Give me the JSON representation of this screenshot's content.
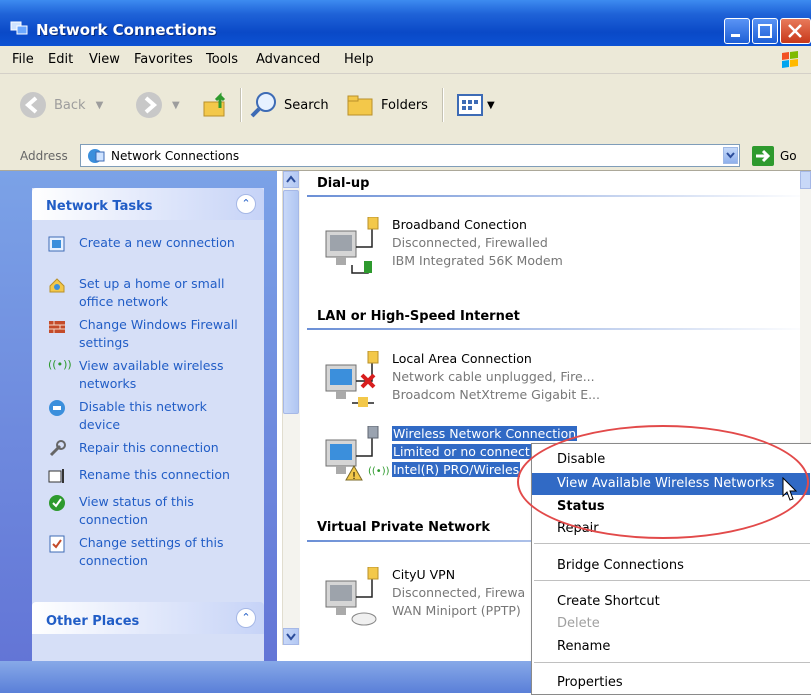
{
  "window": {
    "title": "Network Connections"
  },
  "menu": [
    "File",
    "Edit",
    "View",
    "Favorites",
    "Tools",
    "Advanced",
    "Help"
  ],
  "toolbar": {
    "back": "Back",
    "search": "Search",
    "folders": "Folders"
  },
  "address": {
    "label": "Address",
    "value": "Network Connections",
    "go": "Go"
  },
  "network_tasks": {
    "title": "Network Tasks",
    "items": [
      {
        "label": "Create a new connection"
      },
      {
        "label": "Set up a home or small office network"
      },
      {
        "label": "Change Windows Firewall settings"
      },
      {
        "label": "View available wireless networks"
      },
      {
        "label": "Disable this network device"
      },
      {
        "label": "Repair this connection"
      },
      {
        "label": "Rename this connection"
      },
      {
        "label": "View status of this connection"
      },
      {
        "label": "Change settings of this connection"
      }
    ]
  },
  "other_places": {
    "title": "Other Places"
  },
  "groups": {
    "dialup": {
      "title": "Dial-up",
      "item": {
        "name": "Broadband Conection",
        "status": "Disconnected, Firewalled",
        "device": "IBM Integrated 56K Modem"
      }
    },
    "lan": {
      "title": "LAN or High-Speed Internet",
      "local": {
        "name": "Local Area Connection",
        "status": "Network cable unplugged, Fire...",
        "device": "Broadcom NetXtreme Gigabit E..."
      },
      "wireless": {
        "name": "Wireless Network Connection",
        "status": "Limited or no connect",
        "device": "Intel(R) PRO/Wireles"
      }
    },
    "vpn": {
      "title": "Virtual Private Network",
      "item": {
        "name": "CityU VPN",
        "status": "Disconnected, Firewa",
        "device": "WAN Miniport (PPTP)"
      }
    }
  },
  "context_menu": {
    "disable": "Disable",
    "view_wireless": "View Available Wireless Networks",
    "status": "Status",
    "repair": "Repair",
    "bridge": "Bridge Connections",
    "shortcut": "Create Shortcut",
    "delete": "Delete",
    "rename": "Rename",
    "properties": "Properties"
  },
  "colors": {
    "title_bar": "#0a49c7",
    "selection": "#316ac5",
    "task_pane": "#7ba2e7",
    "highlight_ellipse": "#e24a4a"
  }
}
